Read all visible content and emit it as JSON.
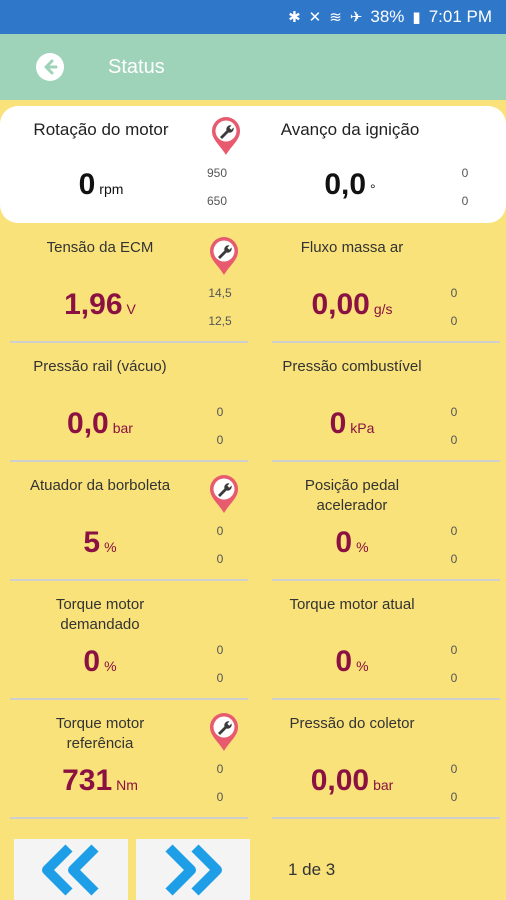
{
  "statusbar": {
    "battery": "38%",
    "time": "7:01 PM"
  },
  "appbar": {
    "title": "Status"
  },
  "top": [
    {
      "label": "Rotação do motor",
      "value": "0",
      "unit": "rpm",
      "max": "950",
      "min": "650"
    },
    {
      "label": "Avanço da ignição",
      "value": "0,0",
      "unit": "°",
      "max": "0",
      "min": "0"
    }
  ],
  "rows": [
    [
      {
        "label": "Tensão da ECM",
        "value": "1,96",
        "unit": "V",
        "max": "14,5",
        "min": "12,5"
      },
      {
        "label": "Fluxo massa ar",
        "value": "0,00",
        "unit": "g/s",
        "max": "0",
        "min": "0"
      }
    ],
    [
      {
        "label": "Pressão rail (vácuo)",
        "value": "0,0",
        "unit": "bar",
        "max": "0",
        "min": "0"
      },
      {
        "label": "Pressão combustível",
        "value": "0",
        "unit": "kPa",
        "max": "0",
        "min": "0"
      }
    ],
    [
      {
        "label": "Atuador da borboleta",
        "value": "5",
        "unit": "%",
        "max": "0",
        "min": "0"
      },
      {
        "label": "Posição pedal\nacelerador",
        "value": "0",
        "unit": "%",
        "max": "0",
        "min": "0"
      }
    ],
    [
      {
        "label": "Torque motor\ndemandado",
        "value": "0",
        "unit": "%",
        "max": "0",
        "min": "0"
      },
      {
        "label": "Torque motor atual",
        "value": "0",
        "unit": "%",
        "max": "0",
        "min": "0"
      }
    ],
    [
      {
        "label": "Torque motor\nreferência",
        "value": "731",
        "unit": "Nm",
        "max": "0",
        "min": "0"
      },
      {
        "label": "Pressão do coletor",
        "value": "0,00",
        "unit": "bar",
        "max": "0",
        "min": "0"
      }
    ]
  ],
  "pagination": {
    "text": "1 de 3"
  },
  "icons": {
    "pin_color": "#e85b6f",
    "nav_arrow_color": "#1f9ee8"
  }
}
